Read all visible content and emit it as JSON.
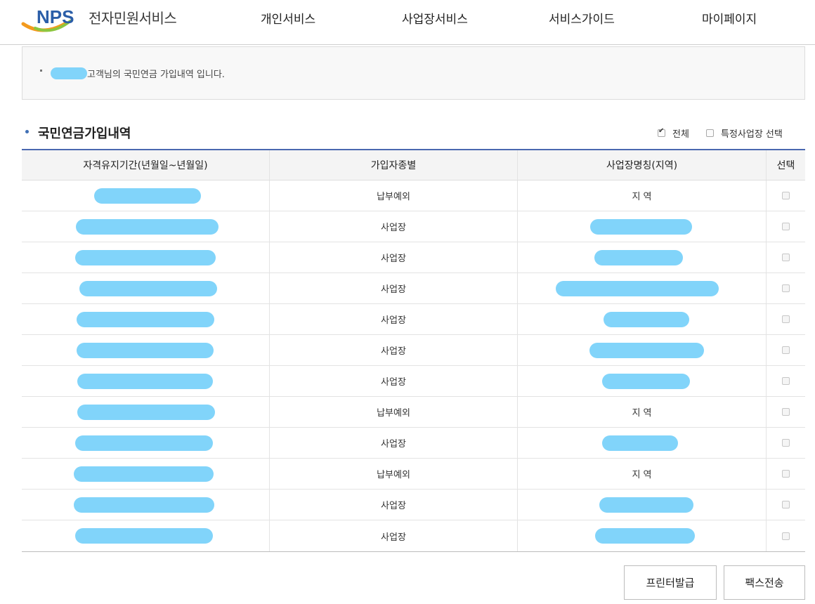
{
  "header": {
    "logo_text": "NPS",
    "service_name": "전자민원서비스",
    "nav": [
      "개인서비스",
      "사업장서비스",
      "서비스가이드",
      "마이페이지"
    ]
  },
  "notice": {
    "text": "고객님의 국민연금 가입내역 입니다."
  },
  "section": {
    "title": "국민연금가입내역",
    "option_all": "전체",
    "option_specific": "특정사업장 선택",
    "option_all_checked": true
  },
  "table": {
    "columns": [
      "자격유지기간(년월일~년월일)",
      "가입자종별",
      "사업장명칭(지역)",
      "선택"
    ],
    "rows": [
      {
        "type": "납부예외",
        "workplace": "지 역"
      },
      {
        "type": "사업장",
        "workplace": ""
      },
      {
        "type": "사업장",
        "workplace": ""
      },
      {
        "type": "사업장",
        "workplace": ""
      },
      {
        "type": "사업장",
        "workplace": ""
      },
      {
        "type": "사업장",
        "workplace": ""
      },
      {
        "type": "사업장",
        "workplace": ""
      },
      {
        "type": "납부예외",
        "workplace": "지 역"
      },
      {
        "type": "사업장",
        "workplace": ""
      },
      {
        "type": "납부예외",
        "workplace": "지 역"
      },
      {
        "type": "사업장",
        "workplace": ""
      },
      {
        "type": "사업장",
        "workplace": ""
      }
    ]
  },
  "buttons": {
    "print": "프린터발급",
    "fax": "팩스전송"
  },
  "colors": {
    "accent": "#4a68b0",
    "redaction": "#81d4fa",
    "logo_blue": "#2b5ea8",
    "logo_orange": "#f39a1e",
    "logo_green": "#8cc63f"
  }
}
